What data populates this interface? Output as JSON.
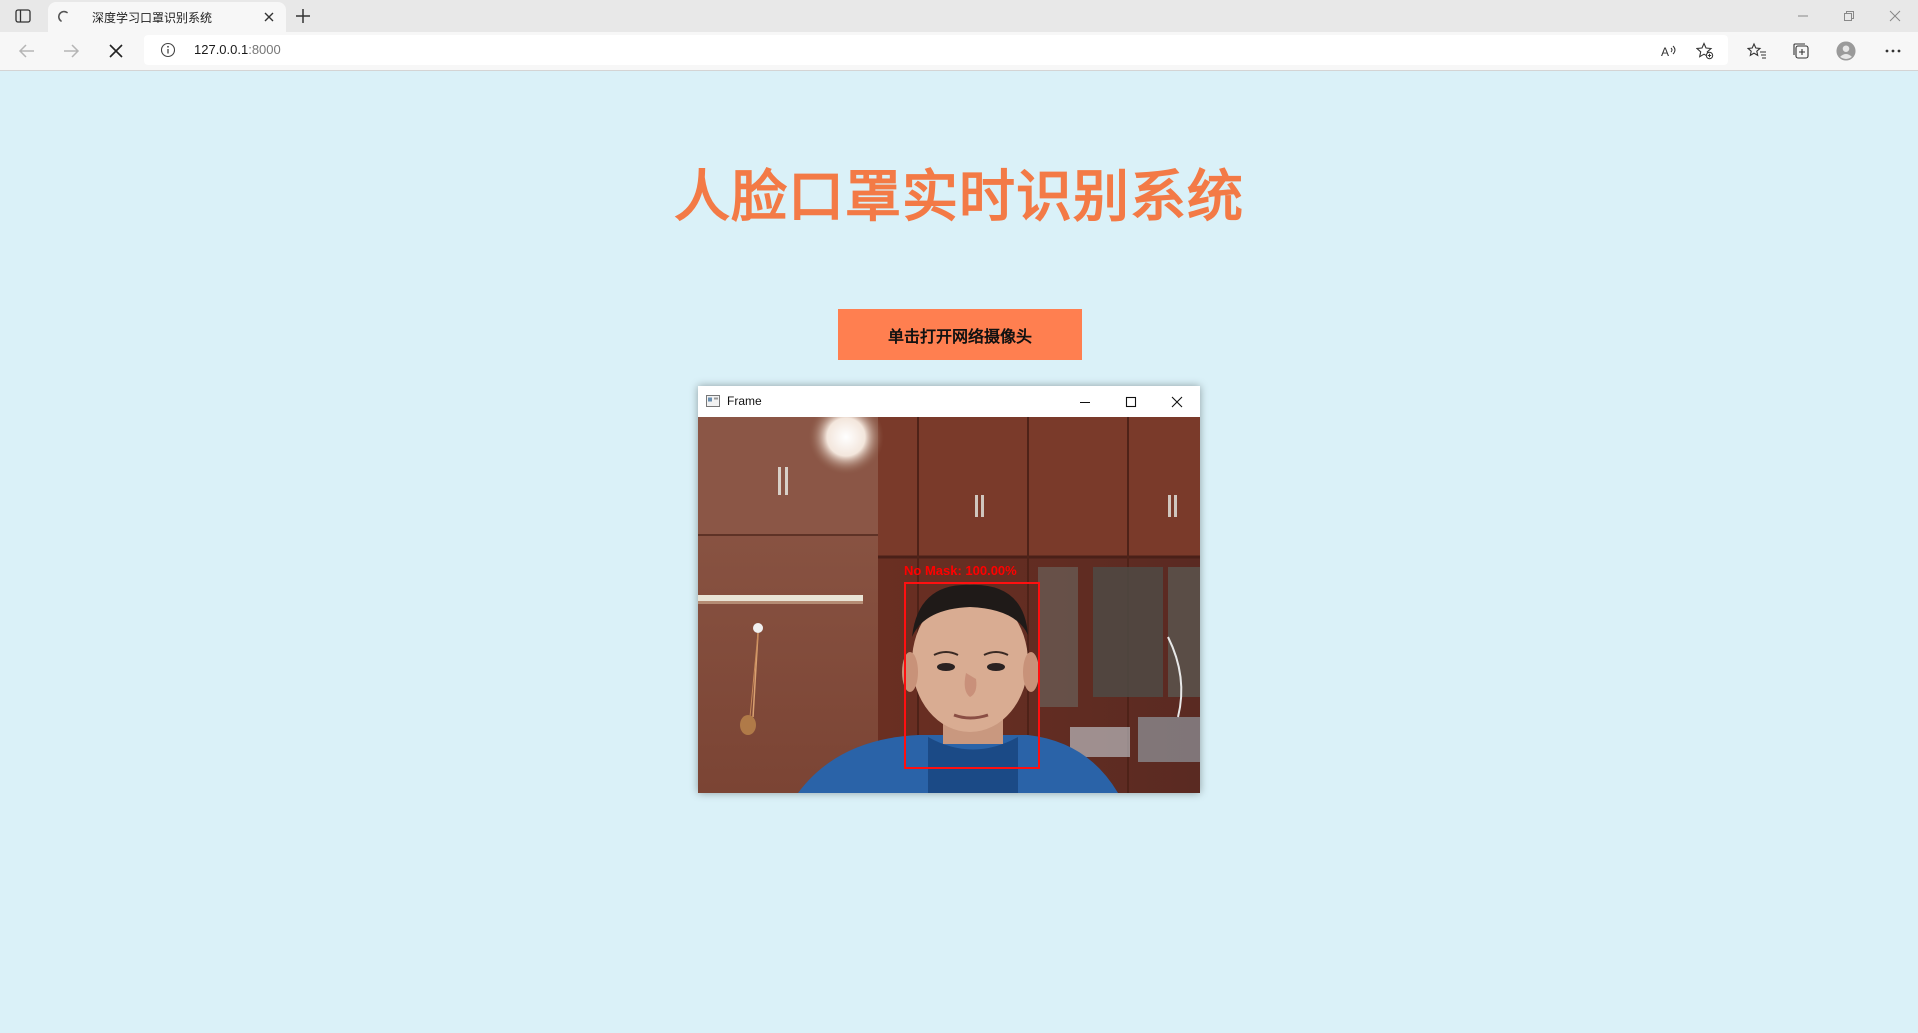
{
  "browser": {
    "tab_title": "深度学习口罩识别系统",
    "url_host": "127.0.0.1",
    "url_port": ":8000"
  },
  "page": {
    "title": "人脸口罩实时识别系统",
    "open_camera_label": "单击打开网络摄像头"
  },
  "frame_window": {
    "title": "Frame",
    "detection_label": "No  Mask:  100.00%"
  },
  "colors": {
    "page_background": "#daf1f8",
    "title_color": "#f37a46",
    "button_background": "#ff7f50",
    "detection_color": "#ff0000"
  }
}
